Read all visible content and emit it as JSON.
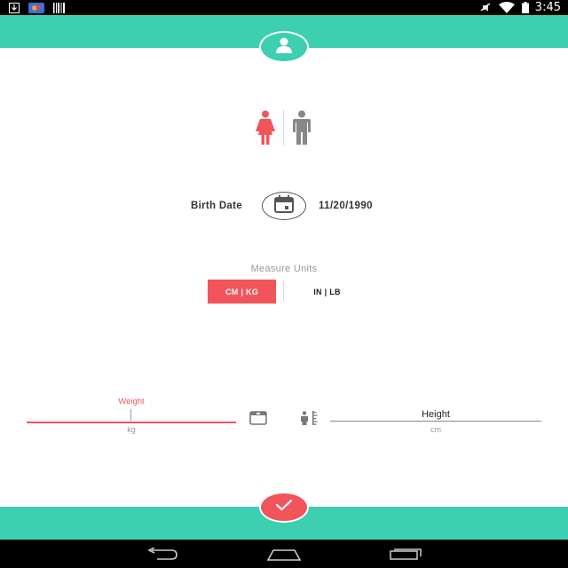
{
  "status_bar": {
    "time": "3:45",
    "icons": [
      "download-icon",
      "photos-icon",
      "barcode-icon",
      "mute-icon",
      "wifi-icon",
      "battery-icon"
    ]
  },
  "header": {
    "icon": "profile-icon"
  },
  "gender": {
    "selected": "female",
    "options": [
      "female-icon",
      "male-icon"
    ]
  },
  "birth_date": {
    "label": "Birth Date",
    "value": "11/20/1990",
    "icon": "calendar-icon"
  },
  "measure_units": {
    "title": "Measure Units",
    "options": [
      "CM | KG",
      "IN | LB"
    ],
    "selected": "CM | KG"
  },
  "weight": {
    "label": "Weight",
    "unit": "kg",
    "icon": "scale-icon"
  },
  "height": {
    "label": "Height",
    "unit": "cm",
    "icon": "height-icon"
  },
  "footer": {
    "icon": "check-icon"
  },
  "colors": {
    "teal": "#3ccfb0",
    "accent_red": "#f2545b",
    "text_dark": "#333333",
    "text_muted": "#999999"
  }
}
